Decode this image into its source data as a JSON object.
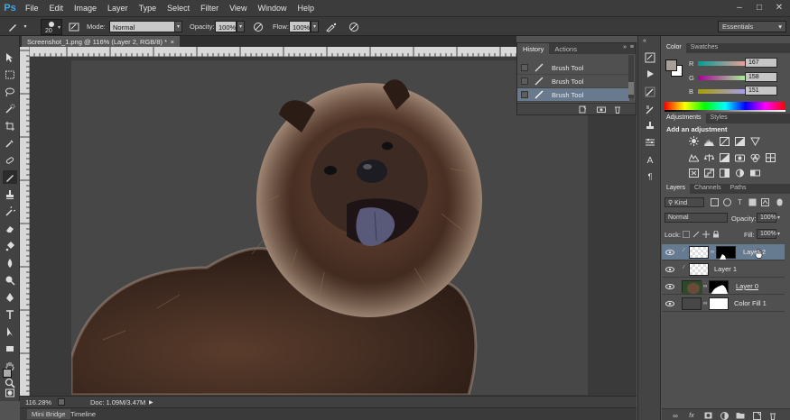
{
  "app": {
    "logo": "Ps",
    "menu": [
      "File",
      "Edit",
      "Image",
      "Layer",
      "Type",
      "Select",
      "Filter",
      "View",
      "Window",
      "Help"
    ],
    "window_controls": [
      "minimize-icon",
      "restore-icon",
      "close-icon"
    ]
  },
  "options_bar": {
    "brush_size": "20",
    "mode_label": "Mode:",
    "mode_value": "Normal",
    "opacity_label": "Opacity:",
    "opacity_value": "100%",
    "flow_label": "Flow:",
    "flow_value": "100%",
    "workspace": "Essentials"
  },
  "document": {
    "tab_title": "Screenshot_1.png @ 116% (Layer 2, RGB/8) *",
    "zoom": "116.28%",
    "doc_size": "Doc: 1.09M/3.47M"
  },
  "bottom_tabs": [
    "Mini Bridge",
    "Timeline"
  ],
  "history": {
    "tabs": [
      "History",
      "Actions"
    ],
    "items": [
      {
        "label": "Brush Tool",
        "active": false
      },
      {
        "label": "Brush Tool",
        "active": false
      },
      {
        "label": "Brush Tool",
        "active": true
      }
    ]
  },
  "color_panel": {
    "tabs": [
      "Color",
      "Swatches"
    ],
    "r": {
      "label": "R",
      "value": "167"
    },
    "g": {
      "label": "G",
      "value": "158"
    },
    "b": {
      "label": "B",
      "value": "151"
    },
    "foreground_color": "#a79e97"
  },
  "adjustments": {
    "tabs": [
      "Adjustments",
      "Styles"
    ],
    "heading": "Add an adjustment"
  },
  "layers_panel": {
    "tabs": [
      "Layers",
      "Channels",
      "Paths"
    ],
    "kind_label": "Kind",
    "blend_mode": "Normal",
    "opacity_label": "Opacity:",
    "opacity_value": "100%",
    "lock_label": "Lock:",
    "fill_label": "Fill:",
    "fill_value": "100%",
    "layers": [
      {
        "name": "Layer 2",
        "selected": true
      },
      {
        "name": "Layer 1",
        "selected": false
      },
      {
        "name": "Layer 0",
        "selected": false
      },
      {
        "name": "Color Fill 1",
        "selected": false
      }
    ]
  },
  "colors": {
    "menubar_bg": "#3c3c3c",
    "panel_bg": "#505050",
    "selected_row": "#667a90",
    "canvas_bg": "#474747"
  }
}
